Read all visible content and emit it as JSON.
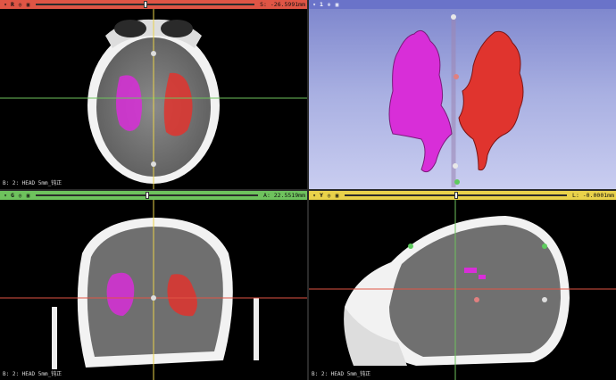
{
  "views": {
    "red": {
      "name": "R",
      "offset": "S: -26.5991mm",
      "caption": "B: 2: HEAD 5mm_钝正",
      "slider": 0.5
    },
    "threed": {
      "name": "1"
    },
    "green": {
      "name": "G",
      "offset": "A: 22.5519mm",
      "caption": "B: 2: HEAD 5mm_钝正",
      "slider": 0.5
    },
    "yellow": {
      "name": "Y",
      "offset": "L: -0.0001mm",
      "caption": "B: 2: HEAD 5mm_钝正",
      "slider": 0.5
    }
  },
  "colors": {
    "red_view": "#e05545",
    "green_view": "#6ec25d",
    "yellow_view": "#e9d24a",
    "threed_view": "#6a73c9",
    "segment_left": "#d82ed8",
    "segment_right": "#e0342e"
  },
  "icons": {
    "pin": "pin-icon",
    "link": "link-icon",
    "eye": "eye-icon",
    "view": "view-controls-icon"
  }
}
